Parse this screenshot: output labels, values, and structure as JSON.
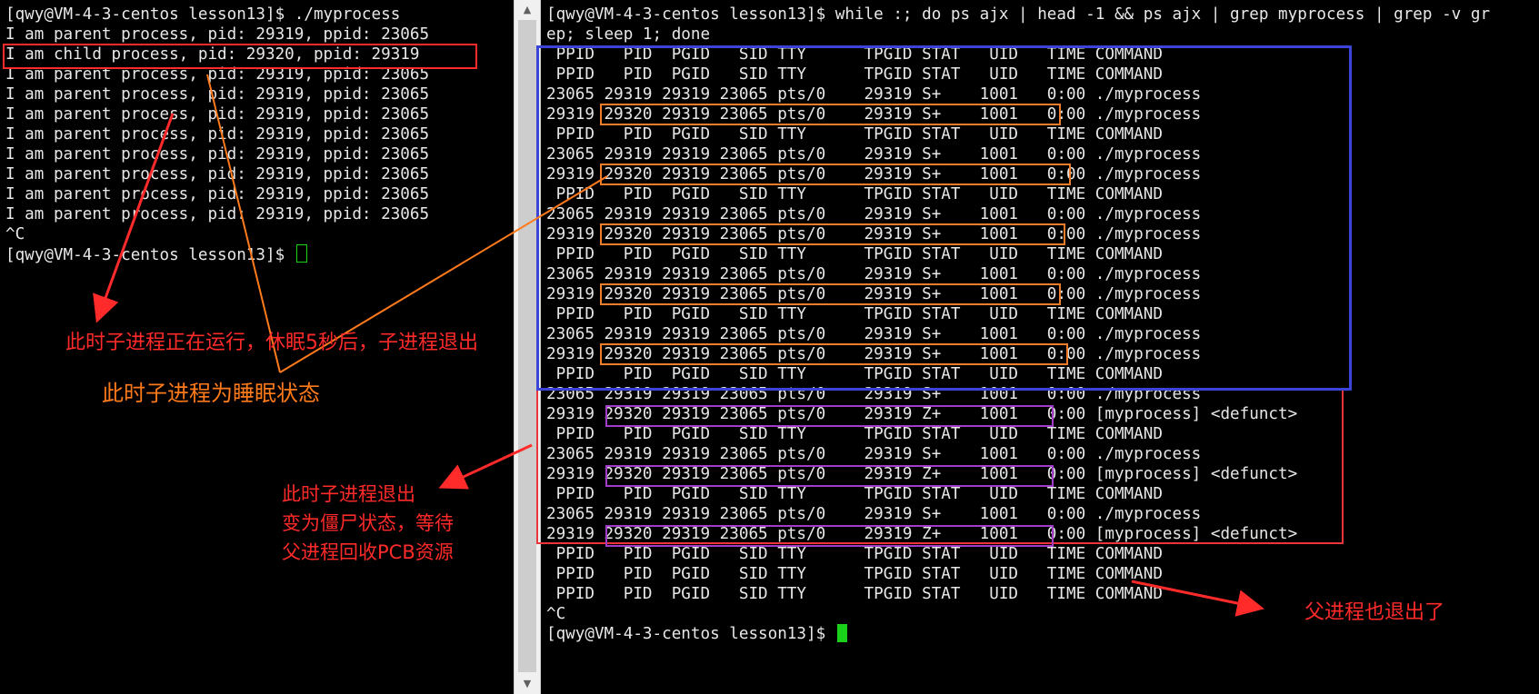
{
  "left_terminal": {
    "lines": [
      "[qwy@VM-4-3-centos lesson13]$ ./myprocess",
      "I am parent process, pid: 29319, ppid: 23065",
      "I am child process, pid: 29320, ppid: 29319",
      "I am parent process, pid: 29319, ppid: 23065",
      "I am parent process, pid: 29319, ppid: 23065",
      "I am parent process, pid: 29319, ppid: 23065",
      "I am parent process, pid: 29319, ppid: 23065",
      "I am parent process, pid: 29319, ppid: 23065",
      "I am parent process, pid: 29319, ppid: 23065",
      "I am parent process, pid: 29319, ppid: 23065",
      "I am parent process, pid: 29319, ppid: 23065",
      "^C"
    ],
    "prompt": "[qwy@VM-4-3-centos lesson13]$ "
  },
  "right_terminal": {
    "lines": [
      "[qwy@VM-4-3-centos lesson13]$ while :; do ps ajx | head -1 && ps ajx | grep myprocess | grep -v gr",
      "ep; sleep 1; done",
      " PPID   PID  PGID   SID TTY      TPGID STAT   UID   TIME COMMAND",
      " PPID   PID  PGID   SID TTY      TPGID STAT   UID   TIME COMMAND",
      "23065 29319 29319 23065 pts/0    29319 S+    1001   0:00 ./myprocess",
      "29319 29320 29319 23065 pts/0    29319 S+    1001   0:00 ./myprocess",
      " PPID   PID  PGID   SID TTY      TPGID STAT   UID   TIME COMMAND",
      "23065 29319 29319 23065 pts/0    29319 S+    1001   0:00 ./myprocess",
      "29319 29320 29319 23065 pts/0    29319 S+    1001   0:00 ./myprocess",
      " PPID   PID  PGID   SID TTY      TPGID STAT   UID   TIME COMMAND",
      "23065 29319 29319 23065 pts/0    29319 S+    1001   0:00 ./myprocess",
      "29319 29320 29319 23065 pts/0    29319 S+    1001   0:00 ./myprocess",
      " PPID   PID  PGID   SID TTY      TPGID STAT   UID   TIME COMMAND",
      "23065 29319 29319 23065 pts/0    29319 S+    1001   0:00 ./myprocess",
      "29319 29320 29319 23065 pts/0    29319 S+    1001   0:00 ./myprocess",
      " PPID   PID  PGID   SID TTY      TPGID STAT   UID   TIME COMMAND",
      "23065 29319 29319 23065 pts/0    29319 S+    1001   0:00 ./myprocess",
      "29319 29320 29319 23065 pts/0    29319 S+    1001   0:00 ./myprocess",
      " PPID   PID  PGID   SID TTY      TPGID STAT   UID   TIME COMMAND",
      "23065 29319 29319 23065 pts/0    29319 S+    1001   0:00 ./myprocess",
      "29319 29320 29319 23065 pts/0    29319 Z+    1001   0:00 [myprocess] <defunct>",
      " PPID   PID  PGID   SID TTY      TPGID STAT   UID   TIME COMMAND",
      "23065 29319 29319 23065 pts/0    29319 S+    1001   0:00 ./myprocess",
      "29319 29320 29319 23065 pts/0    29319 Z+    1001   0:00 [myprocess] <defunct>",
      " PPID   PID  PGID   SID TTY      TPGID STAT   UID   TIME COMMAND",
      "23065 29319 29319 23065 pts/0    29319 S+    1001   0:00 ./myprocess",
      "29319 29320 29319 23065 pts/0    29319 Z+    1001   0:00 [myprocess] <defunct>",
      " PPID   PID  PGID   SID TTY      TPGID STAT   UID   TIME COMMAND",
      " PPID   PID  PGID   SID TTY      TPGID STAT   UID   TIME COMMAND",
      " PPID   PID  PGID   SID TTY      TPGID STAT   UID   TIME COMMAND",
      "^C"
    ],
    "prompt": "[qwy@VM-4-3-centos lesson13]$ "
  },
  "annotations": {
    "child_running_sleep_5s": "此时子进程正在运行，休眠5秒后，子进程退出",
    "child_sleeping": "此时子进程为睡眠状态",
    "zombie_note": "此时子进程退出\n变为僵尸状态，等待\n父进程回收PCB资源",
    "parent_exit": "父进程也退出了"
  },
  "colors": {
    "terminal_bg": "#000000",
    "terminal_text": "#e8e8e8",
    "cursor": "#19d219",
    "annotation_red": "#ff2a2a",
    "annotation_orange": "#ff7a1a",
    "sleep_box": "#f07d2a",
    "zombie_box": "#a03cc8",
    "running_frame": "#3a45d8",
    "zombie_frame": "#e8343a"
  },
  "icons": {
    "scroll_up": "triangle-up-icon",
    "scroll_down": "triangle-down-icon"
  }
}
